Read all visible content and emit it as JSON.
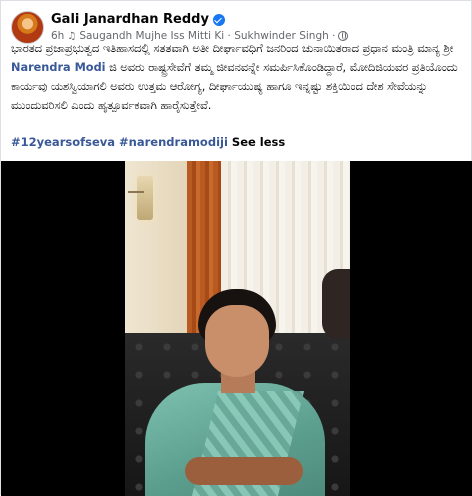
{
  "post": {
    "author": "Gali Janardhan Reddy",
    "time": "6h",
    "music": "Saugandh Mujhe Iss Mitti Ki · Sukhwinder Singh ·",
    "text_before": "ಭಾರತದ ಪ್ರಜಾಪ್ರಭುತ್ವದ ಇತಿಹಾಸದಲ್ಲಿ ಸತತವಾಗಿ ಅತೀ ದೀರ್ಘಾವಧಿಗೆ ಜನರಿಂದ ಚುನಾಯಿತರಾದ ಪ್ರಧಾನ ಮಂತ್ರಿ ಮಾನ್ಯ ಶ್ರೀ ",
    "mention": "Narendra Modi",
    "text_after": " ಜಿ ಅವರು ರಾಷ್ಟ್ರಸೇವೆಗೆ ತಮ್ಮ ಜೀವನವನ್ನೇ ಸಮರ್ಪಿಸಿಕೊಂಡಿದ್ದಾರೆ, ಮೋದಿಜಿಯವರ ಪ್ರತಿಯೊಂದು ಕಾರ್ಯವು ಯಶಸ್ವಿಯಾಗಲಿ ಅವರು ಉತ್ತಮ ಆರೋಗ್ಯ, ದೀರ್ಘಾಯುಷ್ಯ ಹಾಗೂ ಇನ್ನಷ್ಟು ಶಕ್ತಿಯಿಂದ ದೇಶ ಸೇವೆಯನ್ನು ಮುಂದುವರಿಸಲಿ ಎಂದು ಹೃತ್ಪೂರ್ವಕವಾಗಿ ಹಾರೈಸುತ್ತೇವೆ.",
    "hashtag1": "#12yearsofseva",
    "hashtag2": "#narendramodiji",
    "see_less": "See less"
  },
  "icons": {
    "verified": "verified-badge-icon",
    "music": "music-note-icon",
    "privacy": "globe-icon"
  },
  "colors": {
    "link": "#385898",
    "verified": "#1877f2",
    "meta": "#65676b"
  }
}
